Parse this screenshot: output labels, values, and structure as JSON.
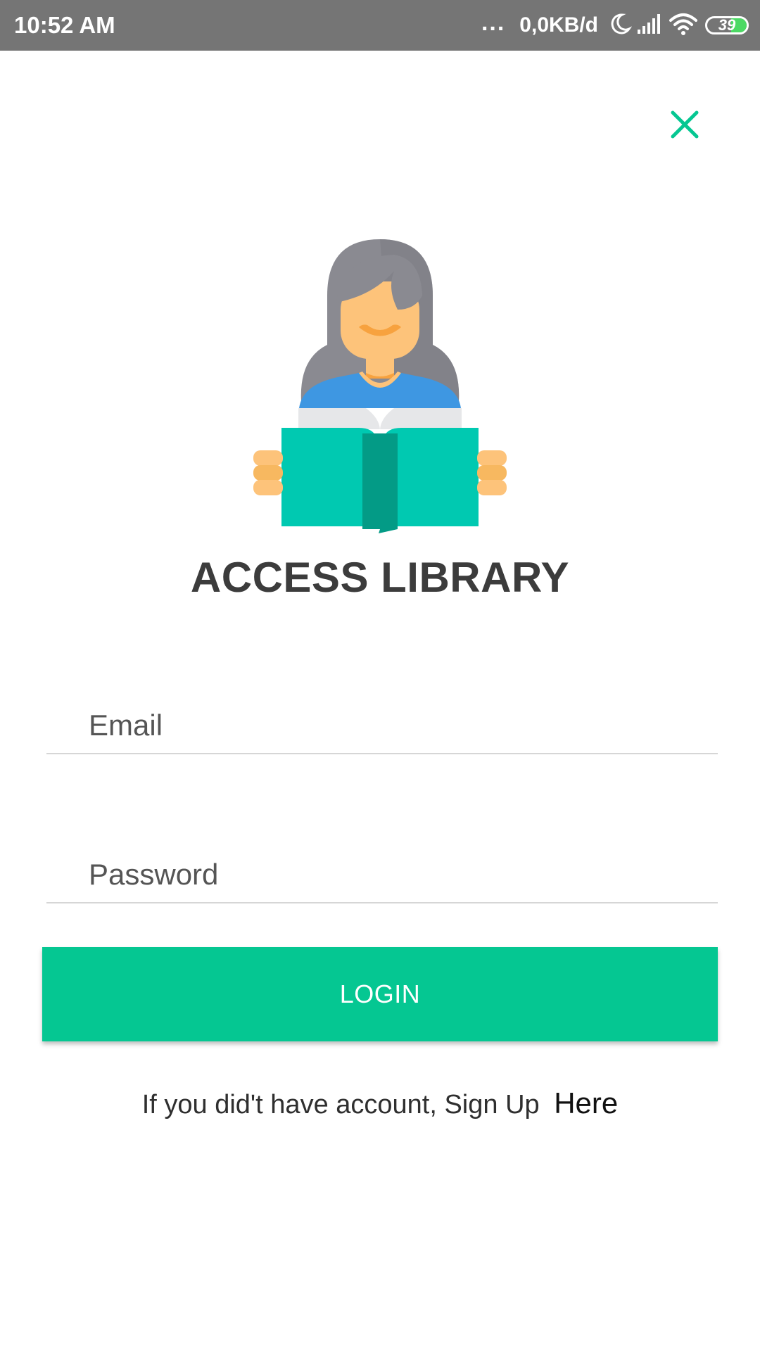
{
  "status_bar": {
    "time": "10:52 AM",
    "dots": "...",
    "network_speed": "0,0KB/d",
    "battery_level": "39",
    "icons": [
      "moon-icon",
      "signal-icon",
      "wifi-icon",
      "battery-icon"
    ]
  },
  "login": {
    "title": "ACCESS LIBRARY",
    "email_placeholder": "Email",
    "email_value": "",
    "password_placeholder": "Password",
    "password_value": "",
    "login_label": "LOGIN",
    "signup_text": "If you did't have account, Sign Up",
    "signup_link": "Here"
  },
  "colors": {
    "accent": "#05c792",
    "status_bar": "#757575",
    "title": "#3c3c3c",
    "book": "#00c9b1",
    "book_spine": "#039b86",
    "hair": "#8a8a91",
    "skin": "#fdc37a",
    "shirt": "#3e97e2"
  }
}
